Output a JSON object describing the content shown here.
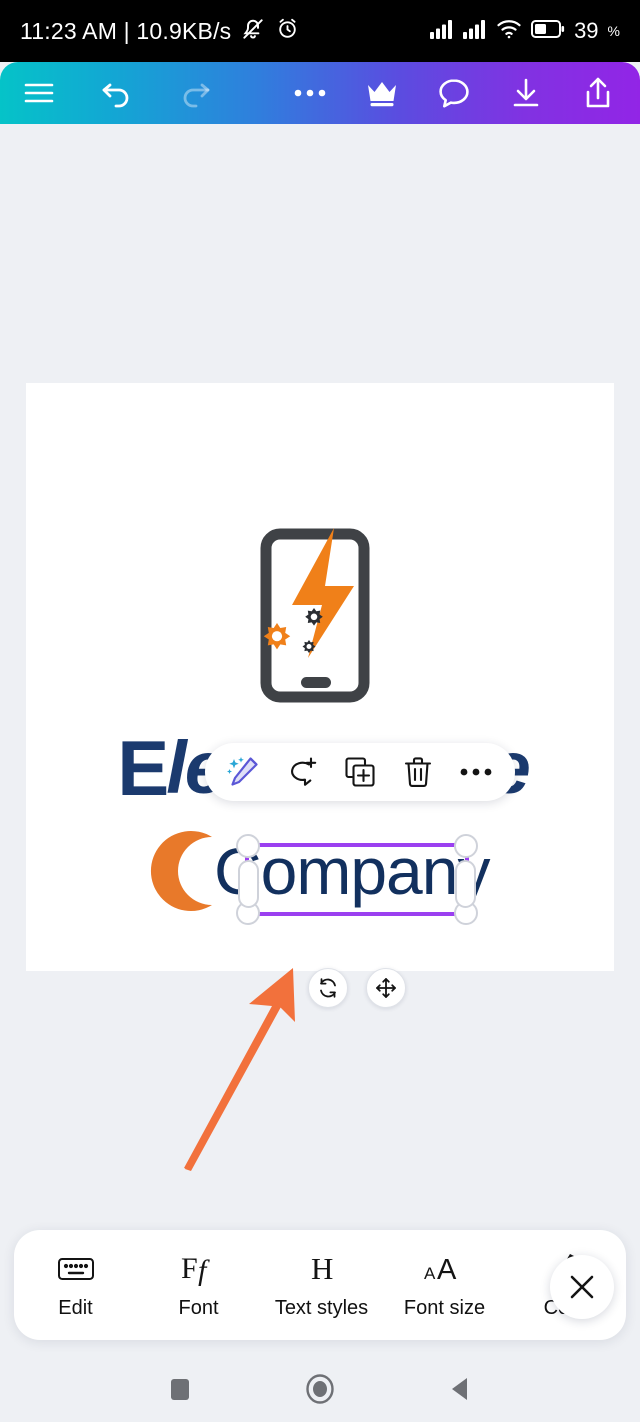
{
  "status_bar": {
    "clock": "11:23 AM | 10.9KB/s",
    "battery_percent": "39",
    "percent_symbol": "%",
    "icons": [
      "mute-bell-icon",
      "alarm-clock-icon",
      "signal-bars-icon",
      "signal-bars-icon",
      "wifi-icon",
      "battery-icon"
    ]
  },
  "top_toolbar": {
    "gradient_start": "#05c3c8",
    "gradient_end": "#9225e6",
    "items": [
      {
        "name": "menu-icon",
        "label": "Menu"
      },
      {
        "name": "undo-icon",
        "label": "Undo"
      },
      {
        "name": "redo-icon",
        "label": "Redo"
      },
      {
        "name": "more-options-icon",
        "label": "More"
      },
      {
        "name": "crown-icon",
        "label": "Premium"
      },
      {
        "name": "comment-icon",
        "label": "Comments"
      },
      {
        "name": "download-icon",
        "label": "Download"
      },
      {
        "name": "share-icon",
        "label": "Share"
      }
    ]
  },
  "canvas": {
    "background": "#ffffff",
    "logo": {
      "name": "phone-lightning-gears-logo",
      "phone_color": "#3f4246",
      "bolt_color": "#f08019",
      "gear_color_primary": "#f08019",
      "gear_color_secondary": "#2b2e33"
    },
    "brand": {
      "line1_first_letter": "E",
      "line1_rest": "lectrowave",
      "line1_full": "Electrowave",
      "line1_color": "#1b3a6e",
      "line2": "Company",
      "line2_color": "#12305e",
      "accent_c_color": "#e8792a"
    }
  },
  "selection": {
    "border_color": "#9b3ff0",
    "handle_fill": "#ffffff",
    "selected_element": "Company"
  },
  "context_toolbar": {
    "items": [
      {
        "name": "magic-edit-icon",
        "label": "AI Edit"
      },
      {
        "name": "add-comment-icon",
        "label": "Comment"
      },
      {
        "name": "duplicate-icon",
        "label": "Duplicate"
      },
      {
        "name": "delete-icon",
        "label": "Delete"
      },
      {
        "name": "more-options-icon",
        "label": "More"
      }
    ]
  },
  "object_controls": [
    {
      "name": "rotate-button",
      "label": "Rotate"
    },
    {
      "name": "move-button",
      "label": "Move"
    }
  ],
  "annotation": {
    "arrow_color": "#f2713c",
    "name": "orange-pointer-arrow"
  },
  "bottom_toolbar": {
    "items": [
      {
        "name": "edit-tool",
        "icon": "keyboard-icon",
        "label": "Edit"
      },
      {
        "name": "font-tool",
        "icon": "font-Ff-icon",
        "label": "Font"
      },
      {
        "name": "text-styles-tool",
        "icon": "heading-H-icon",
        "label": "Text styles"
      },
      {
        "name": "font-size-tool",
        "icon": "font-size-aA-icon",
        "label": "Font size"
      },
      {
        "name": "color-tool",
        "icon": "color-brush-icon",
        "label": "Color"
      }
    ],
    "close_label": "Close"
  },
  "nav_bar": {
    "items": [
      {
        "name": "recents-button",
        "label": "Recents"
      },
      {
        "name": "home-button",
        "label": "Home"
      },
      {
        "name": "back-button",
        "label": "Back"
      }
    ]
  }
}
